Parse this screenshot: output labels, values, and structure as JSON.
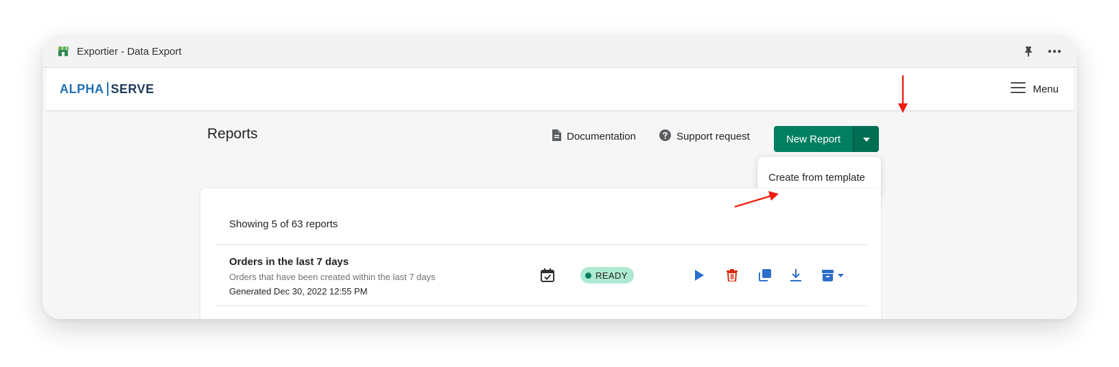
{
  "window": {
    "title": "Exportier - Data Export",
    "app_icon": "store-icon",
    "titlebar_icons": [
      "pin-icon",
      "more-horizontal-icon"
    ]
  },
  "header": {
    "logo_left": "ALPHA",
    "logo_right": "SERVE",
    "menu_label": "Menu",
    "menu_icon": "hamburger-icon"
  },
  "page": {
    "title": "Reports",
    "documentation_label": "Documentation",
    "documentation_icon": "document-icon",
    "support_label": "Support request",
    "support_icon": "question-circle-icon",
    "new_report_label": "New Report",
    "dropdown_item": "Create from template"
  },
  "reports": {
    "showing": "Showing 5 of 63 reports",
    "rows": [
      {
        "title": "Orders in the last 7 days",
        "description": "Orders that have been created within the last 7 days",
        "generated": "Generated Dec 30, 2022 12:55 PM",
        "status": "READY",
        "schedule_icon": "calendar-check-icon",
        "actions": [
          "play-icon",
          "trash-icon",
          "duplicate-icon",
          "download-icon",
          "archive-icon"
        ]
      }
    ]
  },
  "colors": {
    "primary": "#008060",
    "primary_dark": "#006e52",
    "badge_bg": "#aee9d1",
    "action_blue": "#2c6ecb",
    "action_red": "#d72c0d",
    "annotation_red": "#ee1c0e",
    "logo_blue": "#1f6fb5"
  }
}
